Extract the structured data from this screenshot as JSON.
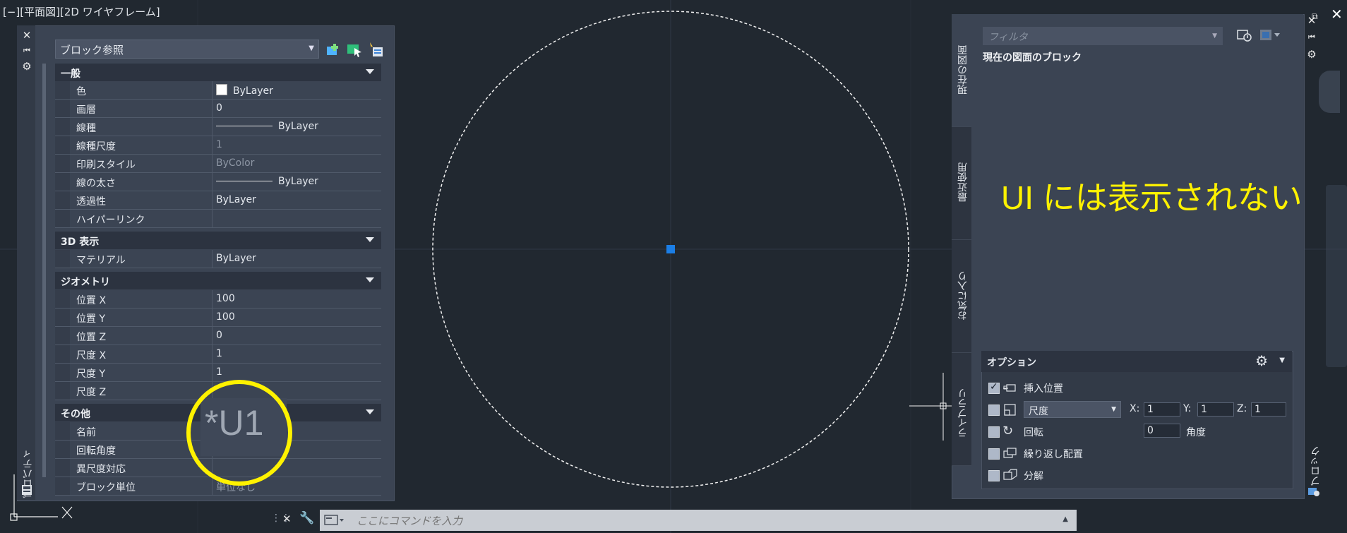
{
  "viewport": {
    "label": "[−][平面図][2D ワイヤフレーム]"
  },
  "properties": {
    "palette_title": "プロパティ",
    "object_type": "ブロック参照",
    "sections": [
      {
        "title": "一般",
        "rows": [
          {
            "label": "色",
            "value": "ByLayer",
            "swatch": "#ffffff"
          },
          {
            "label": "画層",
            "value": "0"
          },
          {
            "label": "線種",
            "value": "ByLayer",
            "line": true
          },
          {
            "label": "線種尺度",
            "value": "1",
            "muted": true
          },
          {
            "label": "印刷スタイル",
            "value": "ByColor",
            "muted": true
          },
          {
            "label": "線の太さ",
            "value": "ByLayer",
            "line": true
          },
          {
            "label": "透過性",
            "value": "ByLayer"
          },
          {
            "label": "ハイパーリンク",
            "value": ""
          }
        ]
      },
      {
        "title": "3D 表示",
        "rows": [
          {
            "label": "マテリアル",
            "value": "ByLayer"
          }
        ]
      },
      {
        "title": "ジオメトリ",
        "rows": [
          {
            "label": "位置 X",
            "value": "100"
          },
          {
            "label": "位置 Y",
            "value": "100"
          },
          {
            "label": "位置 Z",
            "value": "0"
          },
          {
            "label": "尺度 X",
            "value": "1"
          },
          {
            "label": "尺度 Y",
            "value": "1"
          },
          {
            "label": "尺度 Z",
            "value": ""
          }
        ]
      },
      {
        "title": "その他",
        "rows": [
          {
            "label": "名前",
            "value": ""
          },
          {
            "label": "回転角度",
            "value": ""
          },
          {
            "label": "異尺度対応",
            "value": ""
          },
          {
            "label": "ブロック単位",
            "value": "単位なし",
            "muted": true
          }
        ]
      }
    ],
    "zoom_annotation": "*U1"
  },
  "command": {
    "placeholder": "ここにコマンドを入力"
  },
  "blocks_palette": {
    "title": "ブロック",
    "tabs": [
      "現在の図面",
      "最近使用",
      "お気に入り",
      "ライブラリ"
    ],
    "filter_placeholder": "フィルタ",
    "current_heading": "現在の図面のブロック",
    "note": "UI には表示されない",
    "options": {
      "title": "オプション",
      "insertion_point": {
        "label": "挿入位置",
        "checked": true
      },
      "scale": {
        "mode": "尺度",
        "x_label": "X:",
        "x": "1",
        "y_label": "Y:",
        "y": "1",
        "z_label": "Z:",
        "z": "1",
        "checked": false
      },
      "rotation": {
        "label": "回転",
        "angle": "0",
        "unit_label": "角度",
        "checked": false
      },
      "repeat": {
        "label": "繰り返し配置",
        "checked": false
      },
      "explode": {
        "label": "分解",
        "checked": false
      }
    }
  },
  "colors": {
    "accent": "#fff200",
    "grip": "#1b7ee6",
    "canvas": "#212830"
  }
}
